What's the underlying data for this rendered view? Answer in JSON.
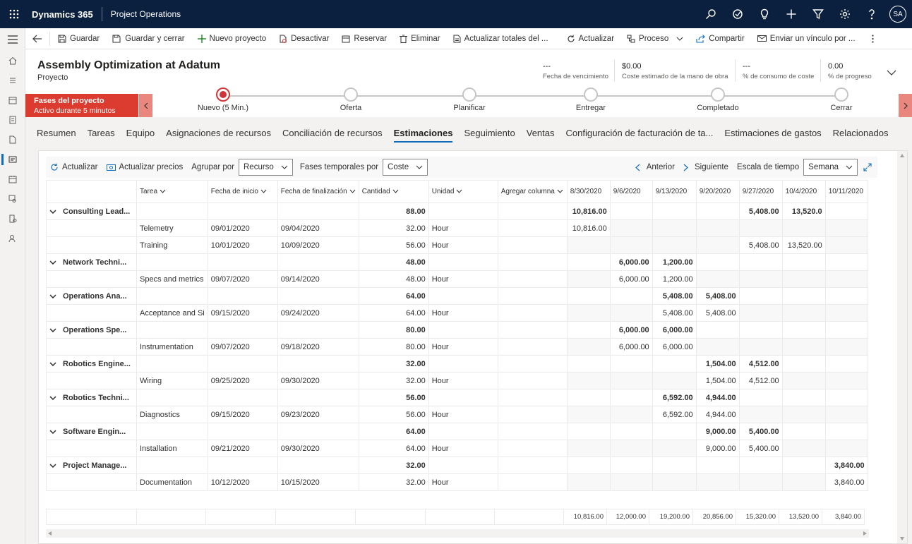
{
  "app": {
    "brand": "Dynamics 365",
    "name": "Project Operations",
    "user_initials": "SA"
  },
  "commands": [
    {
      "label": "Guardar",
      "icon": "save-icon"
    },
    {
      "label": "Guardar y cerrar",
      "icon": "save-close-icon"
    },
    {
      "label": "Nuevo proyecto",
      "icon": "plus-icon"
    },
    {
      "label": "Desactivar",
      "icon": "deactivate-icon"
    },
    {
      "label": "Reservar",
      "icon": "calendar-icon"
    },
    {
      "label": "Eliminar",
      "icon": "trash-icon"
    },
    {
      "label": "Actualizar totales del ...",
      "icon": "document-icon"
    },
    {
      "label": "Actualizar",
      "icon": "refresh-icon"
    },
    {
      "label": "Proceso",
      "icon": "process-icon"
    },
    {
      "label": "Compartir",
      "icon": "share-icon"
    },
    {
      "label": "Enviar un vínculo por ...",
      "icon": "mail-icon"
    }
  ],
  "record": {
    "title": "Assembly Optimization at Adatum",
    "entity": "Proyecto",
    "fields": [
      {
        "value": "---",
        "label": "Fecha de vencimiento"
      },
      {
        "value": "$0.00",
        "label": "Coste estimado de la mano de obra"
      },
      {
        "value": "---",
        "label": "% de consumo de coste"
      },
      {
        "value": "0.00",
        "label": "% de progreso"
      }
    ]
  },
  "bpf": {
    "active_title": "Fases del proyecto",
    "active_sub": "Activo durante 5 minutos",
    "stages": [
      "Nuevo  (5 Min.)",
      "Oferta",
      "Planificar",
      "Entregar",
      "Completado",
      "Cerrar"
    ]
  },
  "tabs": [
    "Resumen",
    "Tareas",
    "Equipo",
    "Asignaciones de recursos",
    "Conciliación de recursos",
    "Estimaciones",
    "Seguimiento",
    "Ventas",
    "Configuración de facturación de ta...",
    "Estimaciones de gastos",
    "Relacionados"
  ],
  "toolbar": {
    "refresh": "Actualizar",
    "update_prices": "Actualizar precios",
    "group_by_label": "Agrupar por",
    "group_by_value": "Recurso",
    "time_phase_label": "Fases temporales por",
    "time_phase_value": "Coste",
    "prev": "Anterior",
    "next": "Siguiente",
    "scale_label": "Escala de tiempo",
    "scale_value": "Semana"
  },
  "columns": [
    "Tarea",
    "Fecha de inicio",
    "Fecha de finalización",
    "Cantidad",
    "Unidad",
    "Agregar columna"
  ],
  "weeks": [
    "8/30/2020",
    "9/6/2020",
    "9/13/2020",
    "9/20/2020",
    "9/27/2020",
    "10/4/2020",
    "10/11/2020"
  ],
  "groups": [
    {
      "name": "Consulting Lead...",
      "qty": "88.00",
      "weeks": [
        "10,816.00",
        "",
        "",
        "",
        "5,408.00",
        "13,520.0",
        ""
      ],
      "tasks": [
        {
          "task": "Telemetry",
          "start": "09/01/2020",
          "end": "09/04/2020",
          "qty": "32.00",
          "unit": "Hour",
          "weeks": [
            "10,816.00",
            "",
            "",
            "",
            "",
            "",
            ""
          ]
        },
        {
          "task": "Training",
          "start": "10/01/2020",
          "end": "10/09/2020",
          "qty": "56.00",
          "unit": "Hour",
          "weeks": [
            "",
            "",
            "",
            "",
            "5,408.00",
            "13,520.00",
            ""
          ]
        }
      ]
    },
    {
      "name": "Network Techni...",
      "qty": "48.00",
      "weeks": [
        "",
        "6,000.00",
        "1,200.00",
        "",
        "",
        "",
        ""
      ],
      "tasks": [
        {
          "task": "Specs and metrics",
          "start": "09/07/2020",
          "end": "09/14/2020",
          "qty": "48.00",
          "unit": "Hour",
          "weeks": [
            "",
            "6,000.00",
            "1,200.00",
            "",
            "",
            "",
            ""
          ]
        }
      ]
    },
    {
      "name": "Operations Ana...",
      "qty": "64.00",
      "weeks": [
        "",
        "",
        "5,408.00",
        "5,408.00",
        "",
        "",
        ""
      ],
      "tasks": [
        {
          "task": "Acceptance and Si",
          "start": "09/15/2020",
          "end": "09/24/2020",
          "qty": "64.00",
          "unit": "Hour",
          "weeks": [
            "",
            "",
            "5,408.00",
            "5,408.00",
            "",
            "",
            ""
          ]
        }
      ]
    },
    {
      "name": "Operations Spe...",
      "qty": "80.00",
      "weeks": [
        "",
        "6,000.00",
        "6,000.00",
        "",
        "",
        "",
        ""
      ],
      "tasks": [
        {
          "task": "Instrumentation",
          "start": "09/07/2020",
          "end": "09/18/2020",
          "qty": "80.00",
          "unit": "Hour",
          "weeks": [
            "",
            "6,000.00",
            "6,000.00",
            "",
            "",
            "",
            ""
          ]
        }
      ]
    },
    {
      "name": "Robotics Engine...",
      "qty": "32.00",
      "weeks": [
        "",
        "",
        "",
        "1,504.00",
        "4,512.00",
        "",
        ""
      ],
      "tasks": [
        {
          "task": "Wiring",
          "start": "09/25/2020",
          "end": "09/30/2020",
          "qty": "32.00",
          "unit": "Hour",
          "weeks": [
            "",
            "",
            "",
            "1,504.00",
            "4,512.00",
            "",
            ""
          ]
        }
      ]
    },
    {
      "name": "Robotics Techni...",
      "qty": "56.00",
      "weeks": [
        "",
        "",
        "6,592.00",
        "4,944.00",
        "",
        "",
        ""
      ],
      "tasks": [
        {
          "task": "Diagnostics",
          "start": "09/15/2020",
          "end": "09/23/2020",
          "qty": "56.00",
          "unit": "Hour",
          "weeks": [
            "",
            "",
            "6,592.00",
            "4,944.00",
            "",
            "",
            ""
          ]
        }
      ]
    },
    {
      "name": "Software Engin...",
      "qty": "64.00",
      "weeks": [
        "",
        "",
        "",
        "9,000.00",
        "5,400.00",
        "",
        ""
      ],
      "tasks": [
        {
          "task": "Installation",
          "start": "09/21/2020",
          "end": "09/30/2020",
          "qty": "64.00",
          "unit": "Hour",
          "weeks": [
            "",
            "",
            "",
            "9,000.00",
            "5,400.00",
            "",
            ""
          ]
        }
      ]
    },
    {
      "name": "Project Manage...",
      "qty": "32.00",
      "weeks": [
        "",
        "",
        "",
        "",
        "",
        "",
        "3,840.00"
      ],
      "tasks": [
        {
          "task": "Documentation",
          "start": "10/12/2020",
          "end": "10/15/2020",
          "qty": "32.00",
          "unit": "Hour",
          "weeks": [
            "",
            "",
            "",
            "",
            "",
            "",
            "3,840.00"
          ]
        }
      ]
    }
  ],
  "totals": [
    "10,816.00",
    "12,000.00",
    "19,200.00",
    "20,856.00",
    "15,320.00",
    "13,520.00",
    "3,840.00"
  ]
}
